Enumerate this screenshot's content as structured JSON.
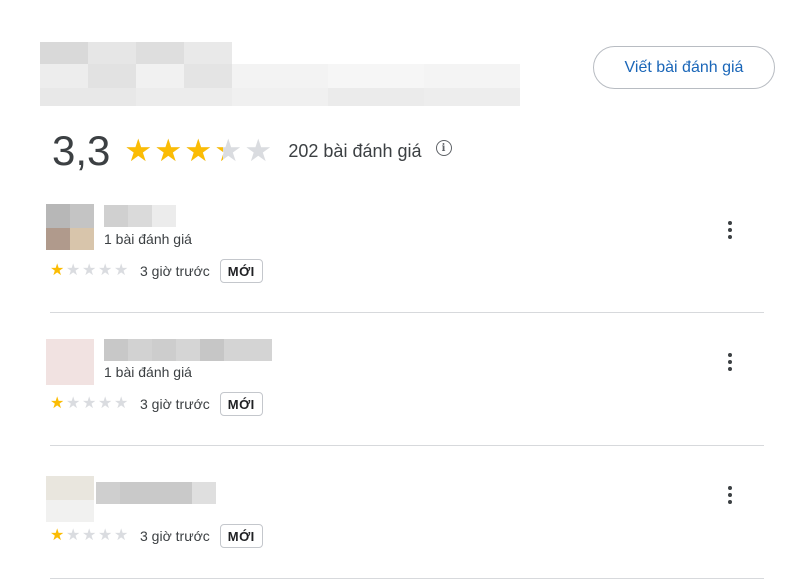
{
  "header": {
    "write_review_label": "Viết bài đánh giá"
  },
  "summary": {
    "average": "3,3",
    "average_value": 3.3,
    "max_stars": 5,
    "count_label": "202 bài đánh giá",
    "info_icon": "info-icon"
  },
  "colors": {
    "star_filled": "#fbbc04",
    "star_empty": "#dadce0",
    "link_blue": "#1a66b8"
  },
  "reviews": [
    {
      "reviewer_count": "1 bài đánh giá",
      "rating": 1,
      "time": "3 giờ trước",
      "badge": "MỚI"
    },
    {
      "reviewer_count": "1 bài đánh giá",
      "rating": 1,
      "time": "3 giờ trước",
      "badge": "MỚI"
    },
    {
      "reviewer_count": "",
      "rating": 1,
      "time": "3 giờ trước",
      "badge": "MỚI"
    }
  ]
}
